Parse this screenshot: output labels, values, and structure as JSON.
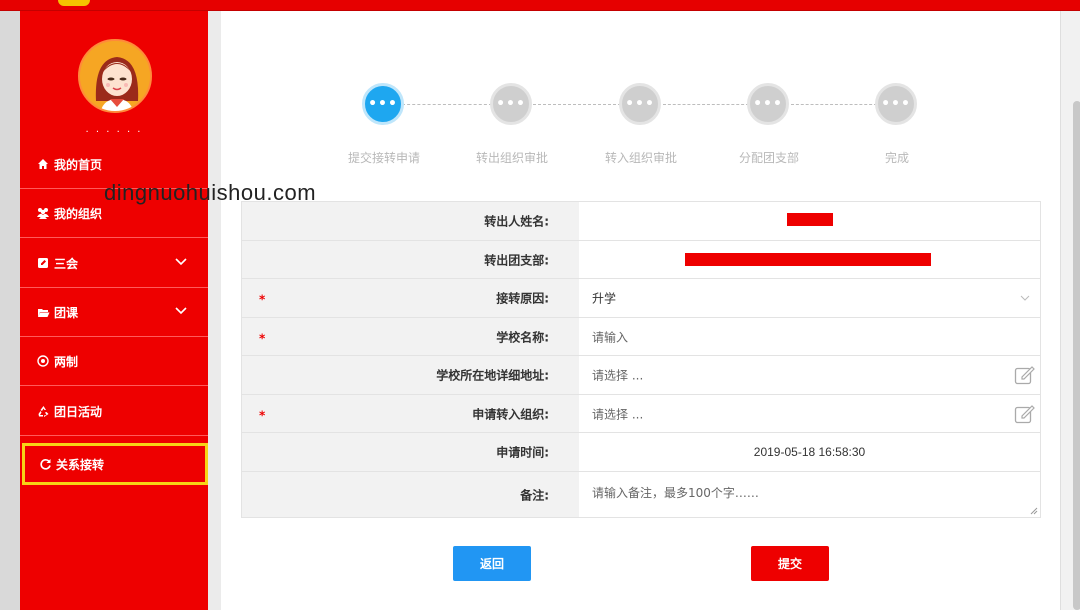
{
  "sidebar": {
    "username": "· · · · · ·",
    "items": [
      {
        "label": "我的首页"
      },
      {
        "label": "我的组织"
      },
      {
        "label": "三会"
      },
      {
        "label": "团课"
      },
      {
        "label": "两制"
      },
      {
        "label": "团日活动"
      },
      {
        "label": "关系接转"
      }
    ]
  },
  "steps": [
    {
      "label": "提交接转申请",
      "status": "active"
    },
    {
      "label": "转出组织审批",
      "status": "pending"
    },
    {
      "label": "转入组织审批",
      "status": "pending"
    },
    {
      "label": "分配团支部",
      "status": "pending"
    },
    {
      "label": "完成",
      "status": "pending"
    }
  ],
  "step_dot_glyph": "•••",
  "watermark": "dingnuohuishou.com",
  "form": {
    "name_label": "转出人姓名:",
    "branch_label": "转出团支部:",
    "reason_label": "接转原因:",
    "reason_value": "升学",
    "school_label": "学校名称:",
    "school_placeholder": "请输入",
    "address_label": "学校所在地详细地址:",
    "address_placeholder": "请选择 ...",
    "org_label": "申请转入组织:",
    "org_placeholder": "请选择 ...",
    "time_label": "申请时间:",
    "time_value": "2019-05-18 16:58:30",
    "note_label": "备注:",
    "note_placeholder": "请输入备注，最多100个字……",
    "required_mark": "*"
  },
  "buttons": {
    "back": "返回",
    "submit": "提交"
  },
  "colors": {
    "brand_red": "#ee0000",
    "active_step": "#1ea7f0",
    "back_button": "#2196f3",
    "active_nav_border": "#f7d416"
  }
}
